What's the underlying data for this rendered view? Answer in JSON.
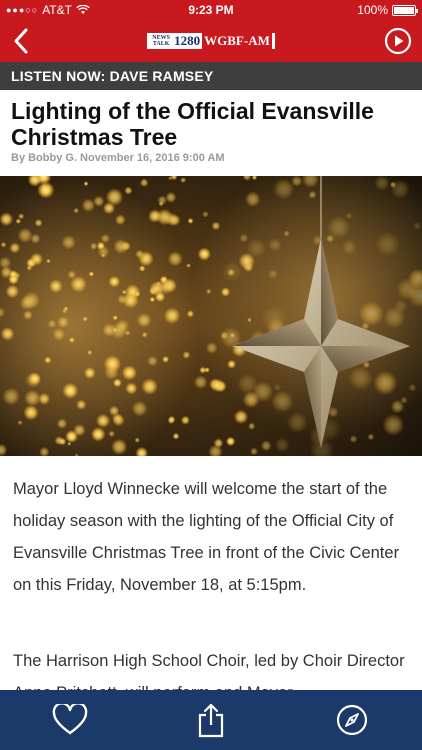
{
  "status_bar": {
    "carrier": "AT&T",
    "time": "9:23 PM",
    "battery": "100%"
  },
  "header": {
    "logo_small": "NEWS TALK",
    "logo_freq": "1280",
    "logo_call": "WGBF-AM"
  },
  "listen_now": "LISTEN NOW: DAVE RAMSEY",
  "article": {
    "title": "Lighting of the Official Evansville Christmas Tree",
    "byline": "By Bobby G. November 16, 2016 9:00 AM",
    "paragraphs": [
      "Mayor Lloyd Winnecke will welcome the start of the holiday season with the lighting of the Official City of Evansville Christmas Tree in front of the Civic Center on this Friday, November 18, at 5:15pm.",
      "The Harrison High School Choir, led by Choir Director Anne Pritchett, will perform and Mayor"
    ]
  },
  "colors": {
    "brand_red": "#c8191f",
    "listen_bar": "#3e3e3e",
    "tab_bar": "#1b3a6a"
  },
  "icons": {
    "back": "back-arrow-icon",
    "play": "play-circle-icon",
    "favorite": "heart-icon",
    "share": "share-icon",
    "browse": "compass-icon"
  }
}
